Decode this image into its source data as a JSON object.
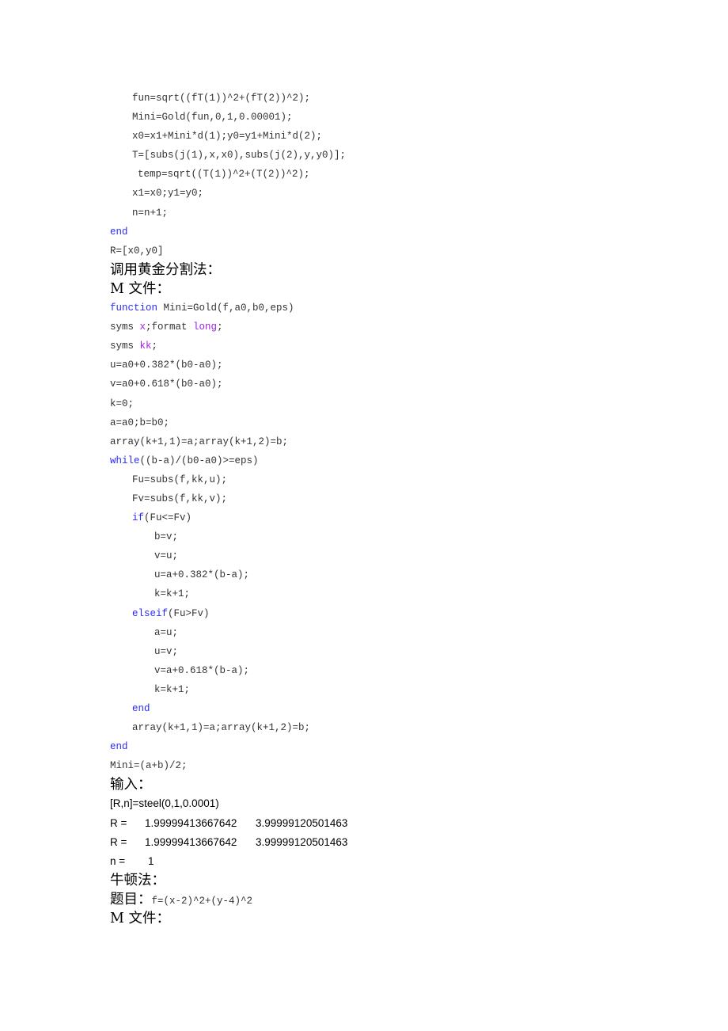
{
  "code_block_1": {
    "lines": [
      "fun=sqrt((fT(1))^2+(fT(2))^2);",
      "Mini=Gold(fun,0,1,0.00001);",
      "x0=x1+Mini*d(1);y0=y1+Mini*d(2);",
      "T=[subs(j(1),x,x0),subs(j(2),y,y0)];",
      "temp=sqrt((T(1))^2+(T(2))^2);",
      "x1=x0;y1=y0;",
      "n=n+1;",
      "end",
      "R=[x0,y0]"
    ]
  },
  "heading_gold": "调用黄金分割法：",
  "heading_mfile_1": "M 文件：",
  "code_block_2": {
    "l0_kw": "function",
    "l0_rest": " Mini=Gold(f,a0,b0,eps)",
    "l1_a": "syms ",
    "l1_b": "x",
    "l1_c": ";format ",
    "l1_d": "long",
    "l1_e": ";",
    "l2_a": "syms ",
    "l2_b": "kk",
    "l2_c": ";",
    "l3": "u=a0+0.382*(b0-a0);",
    "l4": "v=a0+0.618*(b0-a0);",
    "l5": "k=0;",
    "l6": "a=a0;b=b0;",
    "l7": "array(k+1,1)=a;array(k+1,2)=b;",
    "l8_kw": "while",
    "l8_rest": "((b-a)/(b0-a0)>=eps)",
    "l9": "Fu=subs(f,kk,u);",
    "l10": "Fv=subs(f,kk,v);",
    "l11_kw": "if",
    "l11_rest": "(Fu<=Fv)",
    "l12": "b=v;",
    "l13": "v=u;",
    "l14": "u=a+0.382*(b-a);",
    "l15": "k=k+1;",
    "l16_kw": "elseif",
    "l16_rest": "(Fu>Fv)",
    "l17": "a=u;",
    "l18": "u=v;",
    "l19": "v=a+0.618*(b-a);",
    "l20": "k=k+1;",
    "l21_kw": "end",
    "l22": "array(k+1,1)=a;array(k+1,2)=b;",
    "l23_kw": "end",
    "l24": "Mini=(a+b)/2;"
  },
  "heading_input": "输入：",
  "output": {
    "command": "[R,n]=steel(0,1,0.0001)",
    "rows": [
      {
        "label": "R =",
        "v1": "1.99999413667642",
        "v2": "3.99999120501463"
      },
      {
        "label": "R =",
        "v1": "1.99999413667642",
        "v2": "3.99999120501463"
      },
      {
        "label": "n =",
        "v1": "1",
        "v2": ""
      }
    ]
  },
  "heading_newton": "牛顿法：",
  "problem_label": "题目：",
  "problem_formula": "f=(x-2)^2+(y-4)^2",
  "heading_mfile_2": "M 文件："
}
